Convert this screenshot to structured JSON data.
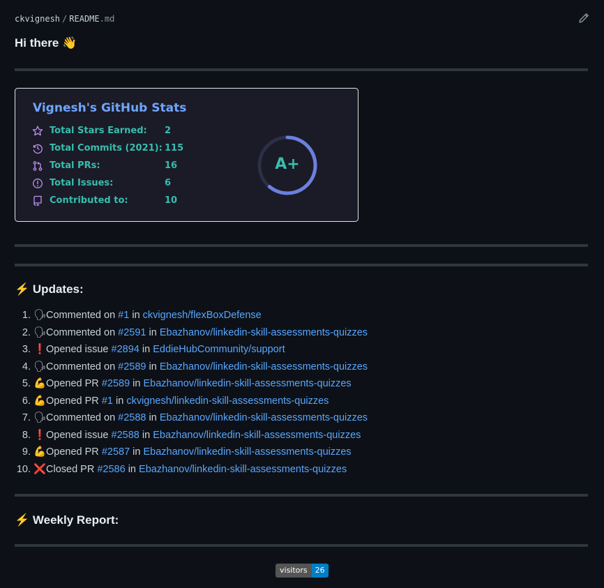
{
  "header": {
    "owner": "ckvignesh",
    "separator": "/",
    "file_base": "README",
    "file_ext": ".md",
    "edit_icon": "pencil-icon"
  },
  "greeting": {
    "text": "Hi there",
    "emoji": "👋"
  },
  "stats_card": {
    "title": "Vignesh's GitHub Stats",
    "accent_color": "#70a5fd",
    "text_color": "#38bdae",
    "icon_color": "#bf91f3",
    "bg_color": "#1a1b27",
    "rows": [
      {
        "icon": "star-icon",
        "label": "Total Stars Earned:",
        "value": "2"
      },
      {
        "icon": "history-icon",
        "label": "Total Commits (2021):",
        "value": "115"
      },
      {
        "icon": "git-pull-request-icon",
        "label": "Total PRs:",
        "value": "16"
      },
      {
        "icon": "issue-icon",
        "label": "Total Issues:",
        "value": "6"
      },
      {
        "icon": "repo-icon",
        "label": "Contributed to:",
        "value": "10"
      }
    ],
    "rank": "A+"
  },
  "updates": {
    "icon": "⚡",
    "heading": "Updates:",
    "items": [
      {
        "emoji": "🗣",
        "action": "Commented on",
        "ref": "#1",
        "in": "in",
        "repo": "ckvignesh/flexBoxDefense"
      },
      {
        "emoji": "🗣",
        "action": "Commented on",
        "ref": "#2591",
        "in": "in",
        "repo": "Ebazhanov/linkedin-skill-assessments-quizzes"
      },
      {
        "emoji": "❗",
        "action": "Opened issue",
        "ref": "#2894",
        "in": "in",
        "repo": "EddieHubCommunity/support"
      },
      {
        "emoji": "🗣",
        "action": "Commented on",
        "ref": "#2589",
        "in": "in",
        "repo": "Ebazhanov/linkedin-skill-assessments-quizzes"
      },
      {
        "emoji": "💪",
        "action": "Opened PR",
        "ref": "#2589",
        "in": "in",
        "repo": "Ebazhanov/linkedin-skill-assessments-quizzes"
      },
      {
        "emoji": "💪",
        "action": "Opened PR",
        "ref": "#1",
        "in": "in",
        "repo": "ckvignesh/linkedin-skill-assessments-quizzes"
      },
      {
        "emoji": "🗣",
        "action": "Commented on",
        "ref": "#2588",
        "in": "in",
        "repo": "Ebazhanov/linkedin-skill-assessments-quizzes"
      },
      {
        "emoji": "❗",
        "action": "Opened issue",
        "ref": "#2588",
        "in": "in",
        "repo": "Ebazhanov/linkedin-skill-assessments-quizzes"
      },
      {
        "emoji": "💪",
        "action": "Opened PR",
        "ref": "#2587",
        "in": "in",
        "repo": "Ebazhanov/linkedin-skill-assessments-quizzes"
      },
      {
        "emoji": "❌",
        "action": "Closed PR",
        "ref": "#2586",
        "in": "in",
        "repo": "Ebazhanov/linkedin-skill-assessments-quizzes"
      }
    ]
  },
  "weekly": {
    "icon": "⚡",
    "heading": "Weekly Report:"
  },
  "visitors_badge": {
    "label": "visitors",
    "count": "26"
  }
}
